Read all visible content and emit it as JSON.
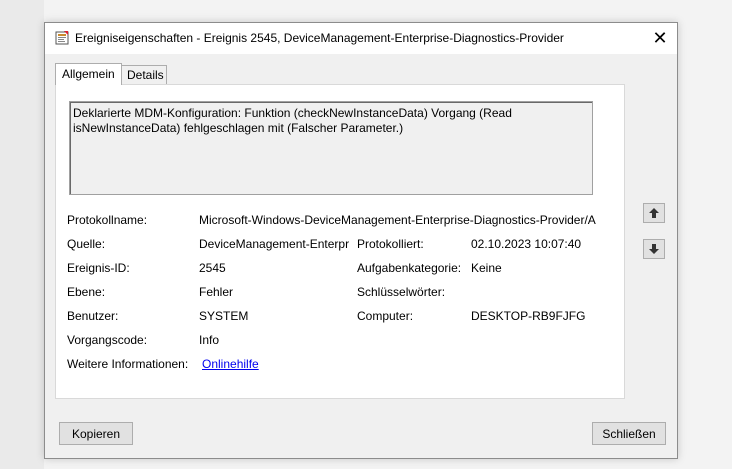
{
  "window": {
    "title": "Ereigniseigenschaften - Ereignis 2545, DeviceManagement-Enterprise-Diagnostics-Provider",
    "icon": "event-viewer-icon",
    "close_label": "✕"
  },
  "tabs": [
    {
      "label": "Allgemein",
      "active": true
    },
    {
      "label": "Details",
      "active": false
    }
  ],
  "general": {
    "description": "Deklarierte MDM-Konfiguration: Funktion (checkNewInstanceData) Vorgang (Read isNewInstanceData) fehlgeschlagen mit (Falscher Parameter.)",
    "fields": {
      "protokollname_label": "Protokollname:",
      "protokollname_value": "Microsoft-Windows-DeviceManagement-Enterprise-Diagnostics-Provider/A",
      "quelle_label": "Quelle:",
      "quelle_value": "DeviceManagement-Enterpr",
      "protokolliert_label": "Protokolliert:",
      "protokolliert_value": "02.10.2023 10:07:40",
      "ereignis_id_label": "Ereignis-ID:",
      "ereignis_id_value": "2545",
      "aufgabenkategorie_label": "Aufgabenkategorie:",
      "aufgabenkategorie_value": "Keine",
      "ebene_label": "Ebene:",
      "ebene_value": "Fehler",
      "schluesselwoerter_label": "Schlüsselwörter:",
      "schluesselwoerter_value": "",
      "benutzer_label": "Benutzer:",
      "benutzer_value": "SYSTEM",
      "computer_label": "Computer:",
      "computer_value": "DESKTOP-RB9FJFG",
      "vorgangscode_label": "Vorgangscode:",
      "vorgangscode_value": "Info",
      "weitere_label": "Weitere Informationen:",
      "weitere_link": "Onlinehilfe"
    }
  },
  "nav": {
    "up_icon": "arrow-up-icon",
    "down_icon": "arrow-down-icon"
  },
  "buttons": {
    "copy": "Kopieren",
    "close": "Schließen"
  }
}
